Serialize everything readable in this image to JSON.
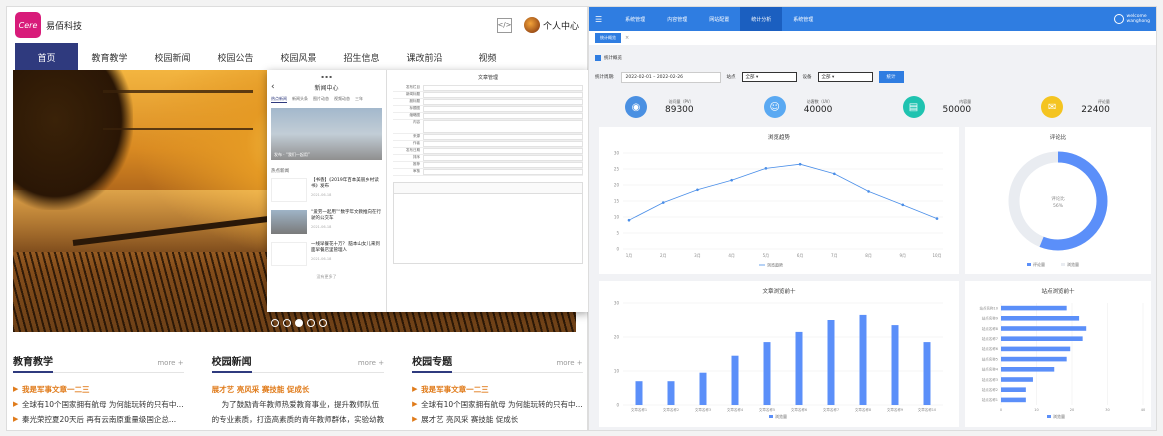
{
  "site": {
    "brand": "易佰科技",
    "user_center": "个人中心",
    "nav": [
      "首页",
      "教育教学",
      "校园新闻",
      "校园公告",
      "校园风景",
      "招生信息",
      "课改前沿",
      "视频"
    ],
    "columns": [
      {
        "title": "教育教学",
        "more": "more +",
        "items": [
          {
            "text": "我是军事文章一二三",
            "hl": true
          },
          {
            "text": "全球有10个国家拥有航母 为何能玩转的只有中...",
            "hl": false
          },
          {
            "text": "秦光荣控夏20天后 再有云南原重量级国企总...",
            "hl": false
          }
        ]
      },
      {
        "title": "校园新闻",
        "more": "more +",
        "items": [
          {
            "text": "展才艺 亮风采 赛技能 促成长",
            "hl": true
          },
          {
            "text": "为了鼓励青年教师热爱教育事业，提升教师队伍",
            "hl": false
          },
          {
            "text": "的专业素质，打造高素质的青年教师群体，实验幼教",
            "hl": false
          }
        ]
      },
      {
        "title": "校园专题",
        "more": "more +",
        "items": [
          {
            "text": "我是军事文章一二三",
            "hl": true
          },
          {
            "text": "全球有10个国家拥有航母 为何能玩转的只有中...",
            "hl": false
          },
          {
            "text": "展才艺 亮风采 赛技能 促成长",
            "hl": false
          }
        ]
      }
    ],
    "phone": {
      "title": "新闻中心",
      "tabs": [
        "热点新闻",
        "新闻头条",
        "图片动态",
        "视频动态",
        "三年"
      ],
      "banner_caption": "发布 · “我们一起用”",
      "section": "热点新闻",
      "items": [
        {
          "text": "【书香】《2019年百本美丽乡村读书》发布",
          "date": "2021-06-18"
        },
        {
          "text": "“爱劳一起用”“数字年文教推向在行驶的公交车",
          "date": "2021-06-18"
        },
        {
          "text": "一线早餐花十万？ 脑本山女儿来到面早餐店里管理人",
          "date": "2021-06-18"
        }
      ],
      "more": "没有更多了"
    },
    "form": {
      "title": "文章管理",
      "labels": [
        "发布栏目",
        "新闻标题",
        "副标题",
        "标题图",
        "缩略图",
        "内容",
        "来源",
        "作者",
        "发布日期",
        "排序",
        "推荐",
        "审核"
      ]
    }
  },
  "admin": {
    "nav": [
      "系统管理",
      "内容管理",
      "网站配置",
      "统计分析",
      "系统管理"
    ],
    "active_nav": 3,
    "welcome": "welcome",
    "username": "wanghong",
    "tab": "统计概览",
    "crumb": "统计概览",
    "filter": {
      "range_label": "统计周期:",
      "date_from": "2022-02-01",
      "date_to": "2022-02-26",
      "site_label": "站点",
      "site_value": "全部",
      "device_label": "设备",
      "device_value": "全部",
      "search": "统计"
    },
    "stats": [
      {
        "label": "访问量（PV）",
        "value": "89300",
        "color": "#4a90e2",
        "icon": "eye-icon",
        "glyph": "◉"
      },
      {
        "label": "访客数（UV）",
        "value": "40000",
        "color": "#5aa9f2",
        "icon": "users-icon",
        "glyph": "☺"
      },
      {
        "label": "内容量",
        "value": "50000",
        "color": "#1fc3b0",
        "icon": "document-icon",
        "glyph": "▤"
      },
      {
        "label": "评论量",
        "value": "22400",
        "color": "#f4c420",
        "icon": "comment-icon",
        "glyph": "✉"
      }
    ]
  },
  "chart_data": [
    {
      "type": "line",
      "title": "浏览趋势",
      "categories": [
        "1月",
        "2月",
        "3月",
        "4月",
        "5月",
        "6月",
        "7月",
        "8月",
        "9月",
        "10月"
      ],
      "series": [
        {
          "name": "浏览趋势",
          "values": [
            9,
            14.5,
            18.5,
            21.5,
            25.2,
            26.5,
            23.5,
            18,
            13.8,
            9.5
          ]
        }
      ],
      "ylim": [
        0,
        30
      ],
      "yticks": [
        0,
        5,
        10,
        15,
        20,
        25,
        30
      ],
      "color": "#4a8ee8"
    },
    {
      "type": "pie",
      "title": "评论比",
      "center_label": "评论比",
      "center_value": "56%",
      "slices": [
        {
          "name": "评论量",
          "value": 56,
          "color": "#5b8ff9"
        },
        {
          "name": "浏览量",
          "value": 44,
          "color": "#e9ecf1"
        }
      ]
    },
    {
      "type": "bar",
      "title": "文章浏览前十",
      "categories": [
        "文章名称1",
        "文章名称2",
        "文章名称3",
        "文章名称4",
        "文章名称5",
        "文章名称6",
        "文章名称7",
        "文章名称8",
        "文章名称9",
        "文章名称10"
      ],
      "series": [
        {
          "name": "浏览量",
          "values": [
            7,
            7,
            9.5,
            14.5,
            18.5,
            21.5,
            25,
            26.5,
            23.5,
            18.5
          ]
        }
      ],
      "ylim": [
        0,
        30
      ],
      "yticks": [
        0,
        10,
        20,
        30
      ],
      "color": "#5b8ff9"
    },
    {
      "type": "bar",
      "orientation": "horizontal",
      "title": "站点浏览前十",
      "categories": [
        "站点名称10",
        "站点名称9",
        "站点名称8",
        "站点名称7",
        "站点名称6",
        "站点名称5",
        "站点名称4",
        "站点名称3",
        "站点名称2",
        "站点名称1"
      ],
      "series": [
        {
          "name": "浏览量",
          "values": [
            18.5,
            22,
            24,
            23,
            19.5,
            18.5,
            15,
            9,
            7,
            7
          ]
        }
      ],
      "xlim": [
        0,
        40
      ],
      "xticks": [
        0,
        10,
        20,
        30,
        40
      ],
      "color": "#5b8ff9"
    }
  ]
}
